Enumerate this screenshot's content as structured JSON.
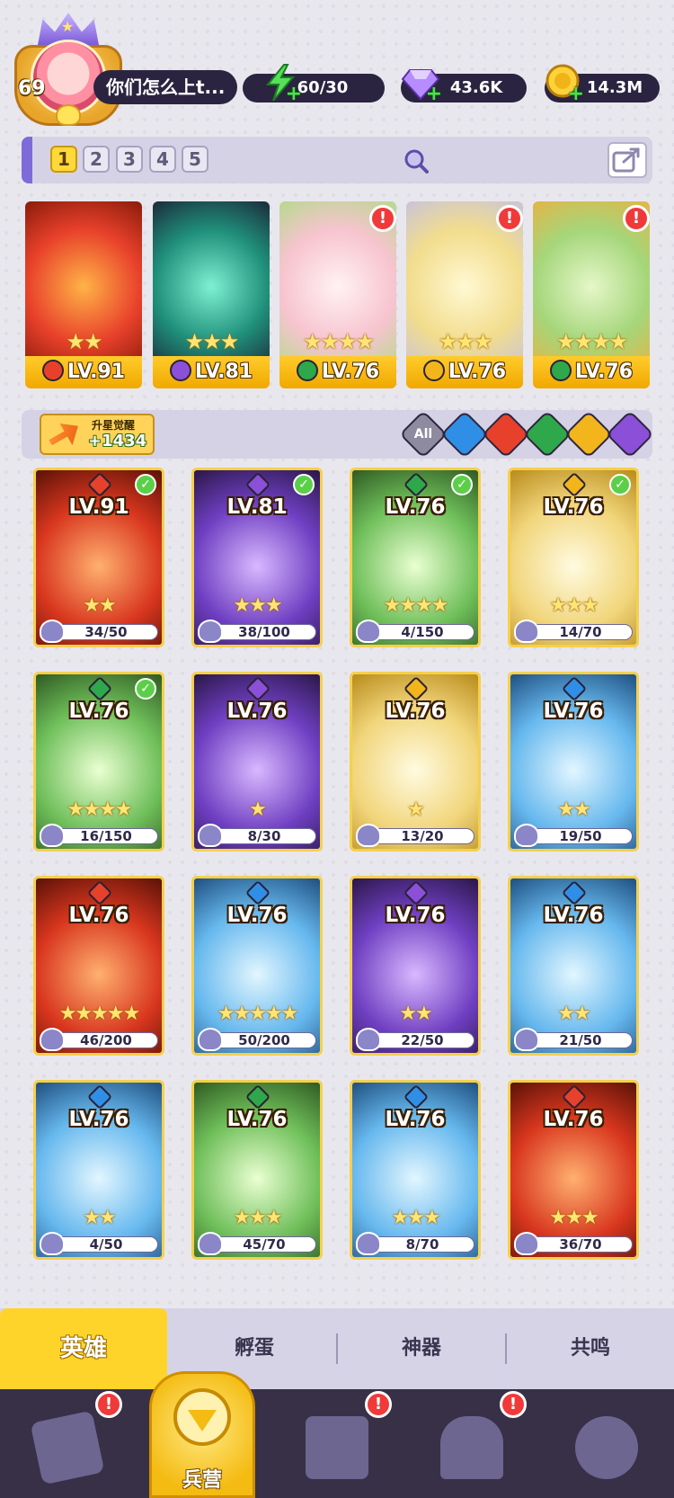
{
  "player": {
    "level": "69",
    "name": "你们怎么上t..."
  },
  "resources": {
    "energy": "60/30",
    "gems": "43.6K",
    "gold": "14.3M",
    "energy_icon": "lightning-icon",
    "gems_icon": "diamond-icon",
    "gold_icon": "coin-icon"
  },
  "team_tabs": [
    "1",
    "2",
    "3",
    "4",
    "5"
  ],
  "team": [
    {
      "level": "LV.91",
      "stars": "★★",
      "element": "fire",
      "alert": false
    },
    {
      "level": "LV.81",
      "stars": "★★★",
      "element": "dark",
      "alert": false
    },
    {
      "level": "LV.76",
      "stars": "★★★★",
      "element": "nature",
      "alert": true
    },
    {
      "level": "LV.76",
      "stars": "★★★",
      "element": "light",
      "alert": true
    },
    {
      "level": "LV.76",
      "stars": "★★★★",
      "element": "nature",
      "alert": true
    }
  ],
  "awaken": {
    "label": "升星觉醒",
    "value": "+1434"
  },
  "filters": {
    "all": "All",
    "elements": [
      "water",
      "fire",
      "nature",
      "light",
      "dark"
    ]
  },
  "heroes": [
    {
      "level": "LV.91",
      "element": "fire",
      "stars": "★★",
      "progress": "34/50",
      "checked": true
    },
    {
      "level": "LV.81",
      "element": "dark",
      "stars": "★★★",
      "progress": "38/100",
      "checked": true
    },
    {
      "level": "LV.76",
      "element": "nature",
      "stars": "★★★★",
      "progress": "4/150",
      "checked": true
    },
    {
      "level": "LV.76",
      "element": "light",
      "stars": "★★★",
      "progress": "14/70",
      "checked": true
    },
    {
      "level": "LV.76",
      "element": "nature",
      "stars": "★★★★",
      "progress": "16/150",
      "checked": true
    },
    {
      "level": "LV.76",
      "element": "dark",
      "stars": "★",
      "progress": "8/30",
      "checked": false
    },
    {
      "level": "LV.76",
      "element": "light",
      "stars": "★",
      "progress": "13/20",
      "checked": false
    },
    {
      "level": "LV.76",
      "element": "water",
      "stars": "★★",
      "progress": "19/50",
      "checked": false
    },
    {
      "level": "LV.76",
      "element": "fire",
      "stars": "★★★★★",
      "progress": "46/200",
      "checked": false
    },
    {
      "level": "LV.76",
      "element": "water",
      "stars": "★★★★★",
      "progress": "50/200",
      "checked": false
    },
    {
      "level": "LV.76",
      "element": "dark",
      "stars": "★★",
      "progress": "22/50",
      "checked": false
    },
    {
      "level": "LV.76",
      "element": "water",
      "stars": "★★",
      "progress": "21/50",
      "checked": false
    },
    {
      "level": "LV.76",
      "element": "water",
      "stars": "★★",
      "progress": "4/50",
      "checked": false
    },
    {
      "level": "LV.76",
      "element": "nature",
      "stars": "★★★",
      "progress": "45/70",
      "checked": false
    },
    {
      "level": "LV.76",
      "element": "water",
      "stars": "★★★",
      "progress": "8/70",
      "checked": false
    },
    {
      "level": "LV.76",
      "element": "fire",
      "stars": "★★★",
      "progress": "36/70",
      "checked": false
    }
  ],
  "sub_tabs": {
    "heroes": "英雄",
    "hatch": "孵蛋",
    "artifacts": "神器",
    "resonance": "共鸣"
  },
  "bottom_nav": {
    "barracks": "兵营"
  },
  "colors": {
    "fire": "#e8412b",
    "dark": "#8b4fd8",
    "nature": "#2ea84a",
    "light": "#f2b51c",
    "water": "#2f8fe6",
    "accent": "#ffd42a",
    "panel": "#d6d2e5"
  }
}
